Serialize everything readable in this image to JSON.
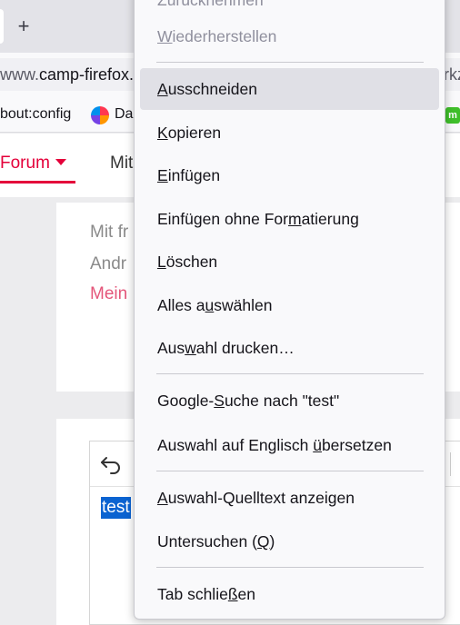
{
  "browser": {
    "new_tab_label": "+",
    "url_prefix": "www.",
    "url_domain": "camp-firefox.",
    "url_tail": "rkz",
    "bookmarks": [
      "bout:config",
      "Da"
    ],
    "extension_badge": "m"
  },
  "page": {
    "nav": {
      "forum_label": "Forum",
      "mit_label": "Mit"
    },
    "post": {
      "signature": [
        "Mit fr",
        "Andr",
        "Mein"
      ]
    },
    "editor": {
      "text": "test"
    }
  },
  "context_menu": {
    "partial_top_item": "Zurücknehmen",
    "items": {
      "restore": {
        "pre": "",
        "key": "W",
        "post": "iederherstellen",
        "disabled": true
      },
      "cut": {
        "pre": "",
        "key": "A",
        "post": "usschneiden",
        "hovered": true
      },
      "copy": {
        "pre": "",
        "key": "K",
        "post": "opieren"
      },
      "paste": {
        "pre": "",
        "key": "E",
        "post": "infügen"
      },
      "paste_plain": {
        "pre": "Einfügen ohne For",
        "key": "m",
        "post": "atierung"
      },
      "delete": {
        "pre": "",
        "key": "L",
        "post": "öschen"
      },
      "select_all": {
        "pre": "Alles a",
        "key": "u",
        "post": "swählen"
      },
      "print_selection": {
        "pre": "Aus",
        "key": "w",
        "post": "ahl drucken…"
      },
      "google_search": {
        "pre": "Google-",
        "key": "S",
        "post": "uche nach \"test\""
      },
      "translate": {
        "pre": "Auswahl auf Englisch ",
        "key": "ü",
        "post": "bersetzen"
      },
      "view_source": {
        "pre": "",
        "key": "A",
        "post": "uswahl-Quelltext anzeigen"
      },
      "inspect": {
        "pre": "Untersuchen (",
        "key": "Q",
        "post": ")"
      },
      "close_tab": {
        "pre": "Tab schlie",
        "key": "ß",
        "post": "en"
      }
    }
  }
}
